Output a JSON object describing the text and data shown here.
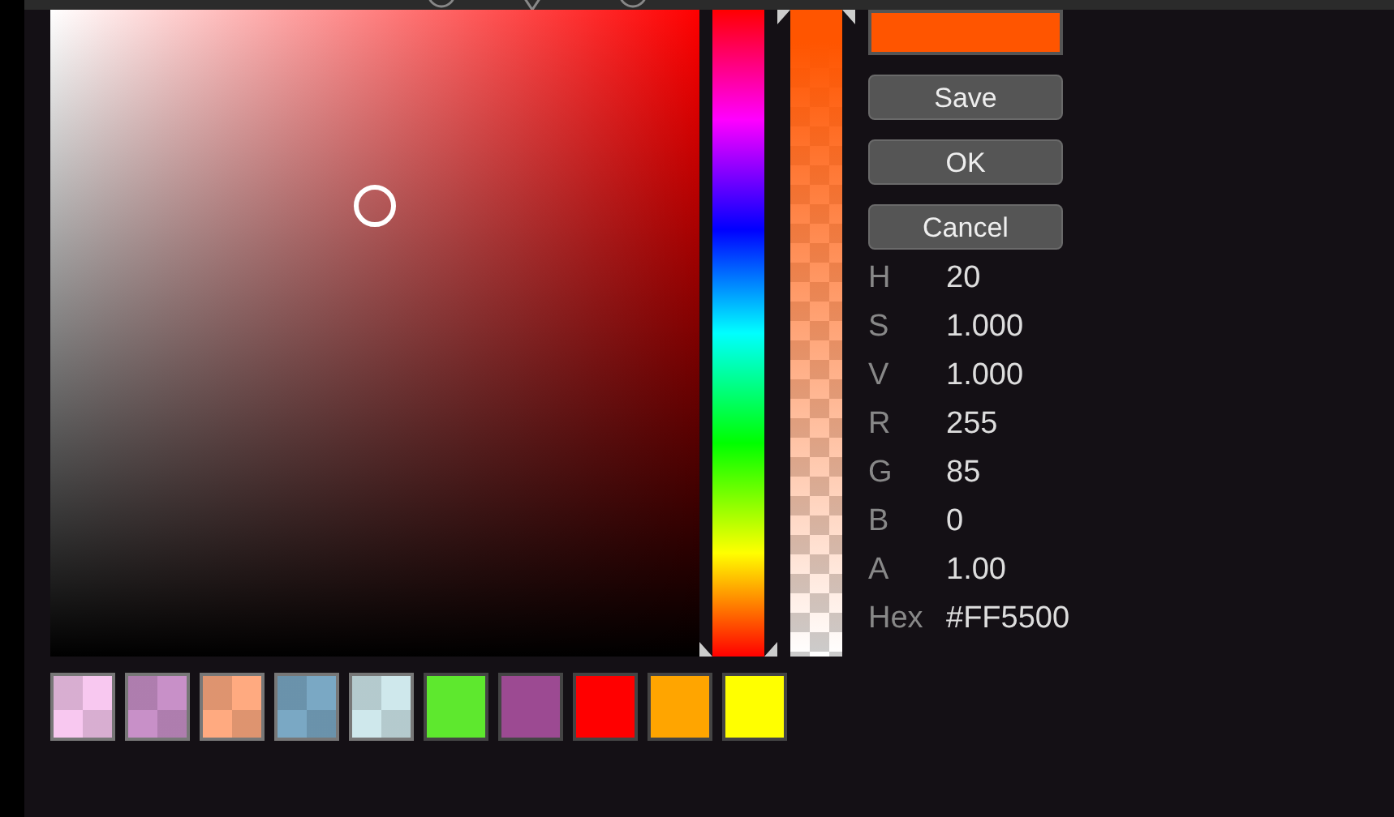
{
  "picker": {
    "color": "#ff5500"
  },
  "alpha_slider": {
    "level": 1
  },
  "buttons": [
    "Save",
    "OK",
    "Cancel"
  ],
  "values": [
    {
      "label": "H",
      "value": "20"
    },
    {
      "label": "S",
      "value": "1.000"
    },
    {
      "label": "V",
      "value": "1.000"
    },
    {
      "label": "R",
      "value": "255"
    },
    {
      "label": "G",
      "value": "85"
    },
    {
      "label": "B",
      "value": "0"
    },
    {
      "label": "A",
      "value": "1.00"
    },
    {
      "label": "Hex",
      "value": "#FF5500"
    }
  ],
  "swatches": [
    {
      "color": "#f8c8f0",
      "kind": "transparent"
    },
    {
      "color": "#c890c8",
      "kind": "transparent"
    },
    {
      "color": "#ffaa80",
      "kind": "transparent"
    },
    {
      "color": "#7aa8c4",
      "kind": "transparent"
    },
    {
      "color": "#cfe8ec",
      "kind": "transparent"
    },
    {
      "color": "#5ee82e",
      "kind": "solid"
    },
    {
      "color": "#9c4a92",
      "kind": "solid"
    },
    {
      "color": "#ff0000",
      "kind": "solid"
    },
    {
      "color": "#ffa500",
      "kind": "solid"
    },
    {
      "color": "#ffff00",
      "kind": "solid"
    }
  ]
}
